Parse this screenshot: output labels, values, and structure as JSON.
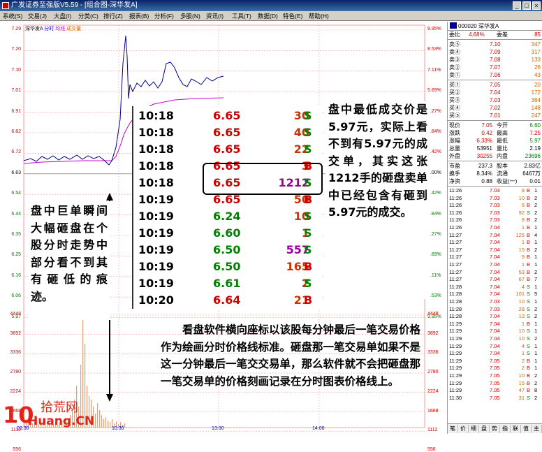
{
  "window": {
    "title": "广发证券至强版V5.59 - [组合图-深华发A]",
    "buttons": [
      "_",
      "□",
      "×"
    ]
  },
  "menu": [
    {
      "label": "系统(S)"
    },
    {
      "label": "交易(J)"
    },
    {
      "label": "大盘(I)"
    },
    {
      "label": "分类(C)"
    },
    {
      "label": "排行(Z)"
    },
    {
      "label": "报表(B)"
    },
    {
      "label": "分析(F)"
    },
    {
      "label": "多股(N)"
    },
    {
      "label": "资讯(I)"
    },
    {
      "label": "工具(T)"
    },
    {
      "label": "数据(D)"
    },
    {
      "label": "特色(E)"
    },
    {
      "label": "帮助(H)"
    }
  ],
  "chart": {
    "stock": "深华发A",
    "tabs": [
      "分时",
      "均线",
      "成交量"
    ],
    "price_ticks_left": [
      "7.29",
      "7.20",
      "7.10",
      "7.01",
      "6.91",
      "6.82",
      "6.72",
      "6.63",
      "6.54",
      "6.44",
      "6.35",
      "6.25",
      "6.16",
      "6.06",
      "5.97"
    ],
    "pct_ticks_right": [
      "9.95%",
      "8.53%",
      "7.11%",
      "5.69%",
      "4.27%",
      "2.84%",
      "1.42%",
      "0.00%",
      "1.42%",
      "2.84%",
      "4.27%",
      "5.69%",
      "7.11%",
      "8.53%",
      "9.95%"
    ],
    "vol_ticks_left": [
      "4448",
      "3892",
      "3336",
      "2780",
      "2224",
      "1668",
      "1112",
      "556"
    ],
    "vol_ticks_right": [
      "4448",
      "3892",
      "3336",
      "2780",
      "2224",
      "1668",
      "1112",
      "556"
    ],
    "time_ticks": [
      "09:30",
      "10:30",
      "13:00",
      "14:00"
    ],
    "colors": {
      "price_line": "#00008b",
      "avg_line": "#cc00cc",
      "volume": "#e8a070",
      "grid": "#ff9999",
      "tick_red": "#cc0000"
    }
  },
  "tape": [
    {
      "time": "10:18",
      "price": "6.65",
      "vol": "30",
      "side": "S",
      "pc": "#cc0000",
      "vc": "#cc3300",
      "sc": "#008000"
    },
    {
      "time": "10:18",
      "price": "6.65",
      "vol": "40",
      "side": "S",
      "pc": "#cc0000",
      "vc": "#cc3300",
      "sc": "#008000"
    },
    {
      "time": "10:18",
      "price": "6.65",
      "vol": "22",
      "side": "S",
      "pc": "#cc0000",
      "vc": "#cc3300",
      "sc": "#008000"
    },
    {
      "time": "10:18",
      "price": "6.65",
      "vol": "3",
      "side": "B",
      "pc": "#cc0000",
      "vc": "#cc3300",
      "sc": "#cc0000"
    },
    {
      "time": "10:18",
      "price": "6.65",
      "vol": "1212",
      "side": "S",
      "pc": "#cc0000",
      "vc": "#990099",
      "sc": "#008000"
    },
    {
      "time": "10:19",
      "price": "6.65",
      "vol": "50",
      "side": "B",
      "pc": "#cc0000",
      "vc": "#cc3300",
      "sc": "#cc0000"
    },
    {
      "time": "10:19",
      "price": "6.24",
      "vol": "10",
      "side": "S",
      "pc": "#008000",
      "vc": "#cc3300",
      "sc": "#008000"
    },
    {
      "time": "10:19",
      "price": "6.60",
      "vol": "1",
      "side": "S",
      "pc": "#008000",
      "vc": "#cc3300",
      "sc": "#008000"
    },
    {
      "time": "10:19",
      "price": "6.50",
      "vol": "557",
      "side": "S",
      "pc": "#008000",
      "vc": "#990099",
      "sc": "#008000"
    },
    {
      "time": "10:19",
      "price": "6.50",
      "vol": "165",
      "side": "B",
      "pc": "#008000",
      "vc": "#cc3300",
      "sc": "#cc0000"
    },
    {
      "time": "10:19",
      "price": "6.61",
      "vol": "2",
      "side": "S",
      "pc": "#008000",
      "vc": "#cc3300",
      "sc": "#008000"
    },
    {
      "time": "10:20",
      "price": "6.64",
      "vol": "21",
      "side": "B",
      "pc": "#cc0000",
      "vc": "#cc3300",
      "sc": "#cc0000"
    }
  ],
  "annotations": {
    "right": "盘中最低成交价是 5.97元，实际上看不到有5.97元的成交单，其实这张 1212手的砸盘卖单中已经包含有砸到5.97元的成交。",
    "left": "盘中巨单瞬间大幅砸盘在个股分时走势中部分看不到其有砸低的痕迹。",
    "bottom": "看盘软件横向座标以该股每分钟最后一笔交易价格作为绘画分时价格线标准。砸盘那一笔交易单如果不是这一分钟最后一笔交交易单，那么软件就不会把砸盘那一笔交易单的价格刻画记录在分时图表价格线上。"
  },
  "side": {
    "code": "000020 深华发A",
    "ratio": {
      "l1": "委比",
      "v1": "4.68%",
      "l2": "委差",
      "v2": "85"
    },
    "asks": [
      {
        "lab": "卖⑤",
        "p": "7.10",
        "v": "347"
      },
      {
        "lab": "卖④",
        "p": "7.09",
        "v": "317"
      },
      {
        "lab": "卖③",
        "p": "7.08",
        "v": "133"
      },
      {
        "lab": "卖②",
        "p": "7.07",
        "v": "26"
      },
      {
        "lab": "卖①",
        "p": "7.06",
        "v": "43"
      }
    ],
    "bids": [
      {
        "lab": "买①",
        "p": "7.05",
        "v": "20"
      },
      {
        "lab": "买②",
        "p": "7.04",
        "v": "172"
      },
      {
        "lab": "买③",
        "p": "7.03",
        "v": "364"
      },
      {
        "lab": "买④",
        "p": "7.02",
        "v": "148"
      },
      {
        "lab": "买⑤",
        "p": "7.01",
        "v": "247"
      }
    ],
    "stats": [
      {
        "l1": "现价",
        "v1": "7.05",
        "l2": "今开",
        "v2": "6.60",
        "c1": "#cc0000",
        "c2": "#008000"
      },
      {
        "l1": "涨跌",
        "v1": "0.42",
        "l2": "最高",
        "v2": "7.25",
        "c1": "#cc0000",
        "c2": "#cc0000"
      },
      {
        "l1": "涨幅",
        "v1": "6.33%",
        "l2": "最低",
        "v2": "5.97",
        "c1": "#cc0000",
        "c2": "#008000"
      },
      {
        "l1": "总量",
        "v1": "53951",
        "l2": "量比",
        "v2": "2.19",
        "c1": "#000000",
        "c2": "#000000"
      },
      {
        "l1": "外盘",
        "v1": "30255",
        "l2": "内盘",
        "v2": "23696",
        "c1": "#cc0000",
        "c2": "#008000"
      }
    ],
    "stats2": [
      {
        "l1": "市盈",
        "v1": "237.3",
        "l2": "股本",
        "v2": "2.83亿"
      },
      {
        "l1": "换手",
        "v1": "8.34%",
        "l2": "流通",
        "v2": "6467万"
      },
      {
        "l1": "净资",
        "v1": "0.88",
        "l2": "收益(一)",
        "v2": "0.01"
      }
    ],
    "ticks": [
      {
        "t": "11:26",
        "p": "7.03",
        "v": "8",
        "s": "B",
        "n": "1"
      },
      {
        "t": "11:26",
        "p": "7.03",
        "v": "10",
        "s": "B",
        "n": "2"
      },
      {
        "t": "11:26",
        "p": "7.03",
        "v": "6",
        "s": "B",
        "n": "2"
      },
      {
        "t": "11:26",
        "p": "7.03",
        "v": "92",
        "s": "S",
        "n": "2"
      },
      {
        "t": "11:26",
        "p": "7.03",
        "v": "8",
        "s": "B",
        "n": "2"
      },
      {
        "t": "11:26",
        "p": "7.04",
        "v": "1",
        "s": "B",
        "n": "1"
      },
      {
        "t": "11:27",
        "p": "7.04",
        "v": "125",
        "s": "B",
        "n": "4"
      },
      {
        "t": "11:27",
        "p": "7.04",
        "v": "1",
        "s": "B",
        "n": "1"
      },
      {
        "t": "11:27",
        "p": "7.04",
        "v": "15",
        "s": "B",
        "n": "2"
      },
      {
        "t": "11:27",
        "p": "7.04",
        "v": "9",
        "s": "B",
        "n": "1"
      },
      {
        "t": "11:27",
        "p": "7.04",
        "v": "1",
        "s": "B",
        "n": "1"
      },
      {
        "t": "11:27",
        "p": "7.04",
        "v": "53",
        "s": "B",
        "n": "2"
      },
      {
        "t": "11:27",
        "p": "7.04",
        "v": "67",
        "s": "B",
        "n": "7"
      },
      {
        "t": "11:28",
        "p": "7.04",
        "v": "4",
        "s": "S",
        "n": "1"
      },
      {
        "t": "11:28",
        "p": "7.04",
        "v": "101",
        "s": "S",
        "n": "5"
      },
      {
        "t": "11:28",
        "p": "7.03",
        "v": "10",
        "s": "S",
        "n": "1"
      },
      {
        "t": "11:28",
        "p": "7.03",
        "v": "28",
        "s": "S",
        "n": "2"
      },
      {
        "t": "11:28",
        "p": "7.04",
        "v": "13",
        "s": "S",
        "n": "2"
      },
      {
        "t": "11:29",
        "p": "7.04",
        "v": "1",
        "s": "B",
        "n": "1"
      },
      {
        "t": "11:29",
        "p": "7.04",
        "v": "10",
        "s": "S",
        "n": "1"
      },
      {
        "t": "11:29",
        "p": "7.04",
        "v": "10",
        "s": "S",
        "n": "2"
      },
      {
        "t": "11:29",
        "p": "7.04",
        "v": "4",
        "s": "S",
        "n": "1"
      },
      {
        "t": "11:29",
        "p": "7.04",
        "v": "1",
        "s": "S",
        "n": "1"
      },
      {
        "t": "11:29",
        "p": "7.05",
        "v": "2",
        "s": "B",
        "n": "1"
      },
      {
        "t": "11:29",
        "p": "7.05",
        "v": "2",
        "s": "B",
        "n": "1"
      },
      {
        "t": "11:29",
        "p": "7.05",
        "v": "10",
        "s": "B",
        "n": "2"
      },
      {
        "t": "11:29",
        "p": "7.05",
        "v": "15",
        "s": "B",
        "n": "2"
      },
      {
        "t": "11:29",
        "p": "7.05",
        "v": "47",
        "s": "B",
        "n": "8"
      },
      {
        "t": "11:30",
        "p": "7.05",
        "v": "31",
        "s": "S",
        "n": "2"
      }
    ],
    "footer_tabs": [
      "笔",
      "价",
      "细",
      "盘",
      "势",
      "指",
      "联",
      "值",
      "主"
    ]
  },
  "logo": {
    "num": "10",
    "cn": "拾荒网",
    "en": "Huang.CN"
  }
}
